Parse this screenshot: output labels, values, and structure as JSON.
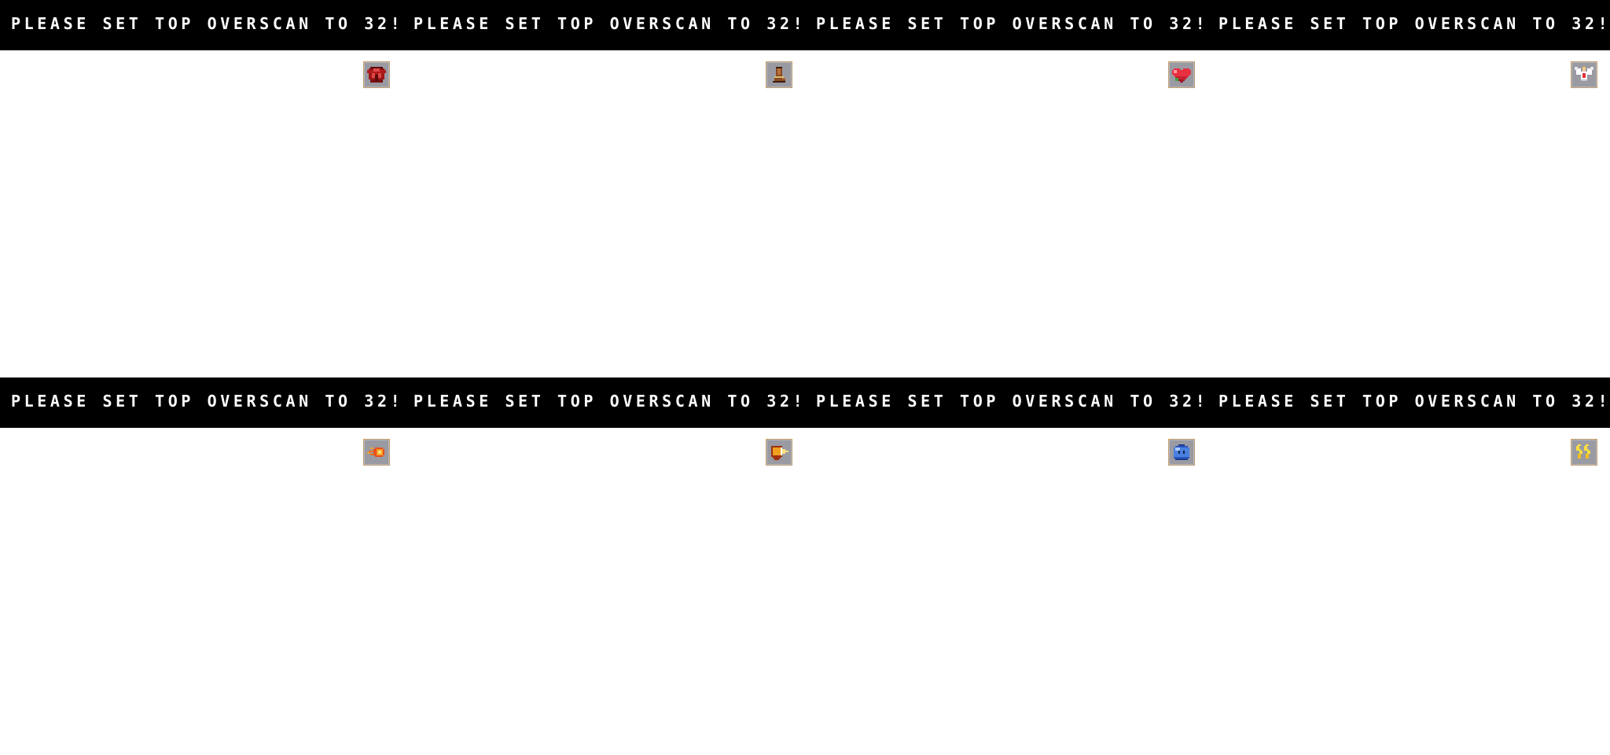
{
  "panels": [
    {
      "banner_text": "PLEASE SET TOP OVERSCAN TO 32!",
      "item_icon": "red-armor-icon"
    },
    {
      "banner_text": "PLEASE SET TOP OVERSCAN TO 32!",
      "item_icon": "boot-icon"
    },
    {
      "banner_text": "PLEASE SET TOP OVERSCAN TO 32!",
      "item_icon": "heart-icon"
    },
    {
      "banner_text": "PLEASE SET TOP OVERSCAN TO 32!",
      "item_icon": "angel-icon"
    },
    {
      "banner_text": "PLEASE SET TOP OVERSCAN TO 32!",
      "item_icon": "fireball-icon"
    },
    {
      "banner_text": "PLEASE SET TOP OVERSCAN TO 32!",
      "item_icon": "arrow-shield-icon"
    },
    {
      "banner_text": "PLEASE SET TOP OVERSCAN TO 32!",
      "item_icon": "blue-slime-icon"
    },
    {
      "banner_text": "PLEASE SET TOP OVERSCAN TO 32!",
      "item_icon": "lightning-icon"
    }
  ],
  "colors": {
    "banner_background": "#000000",
    "banner_text": "#ffffff",
    "screen_background": "#ffffff",
    "slot_background": "#9a9aa2",
    "slot_border": "#e8a13a"
  }
}
